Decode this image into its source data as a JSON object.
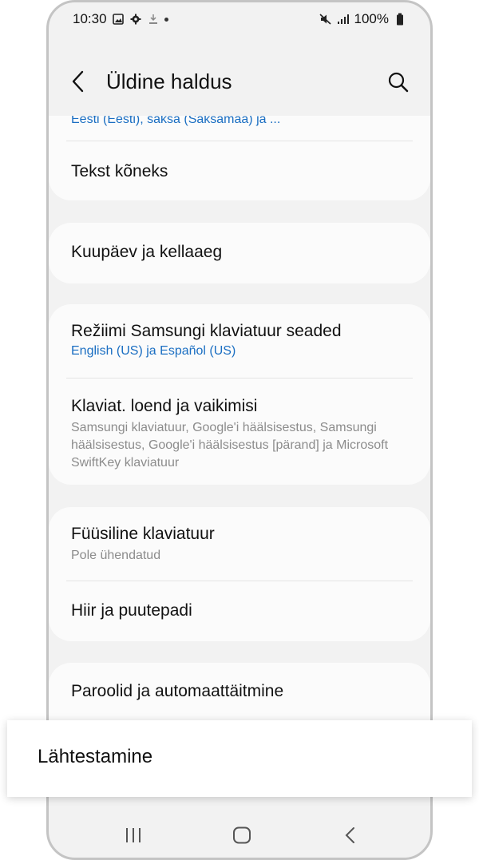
{
  "status_bar": {
    "time": "10:30",
    "battery": "100%"
  },
  "app_bar": {
    "title": "Üldine haldus"
  },
  "items": {
    "languages_subtitle": "Eesti (Eesti), saksa (Saksamaa) ja ...",
    "tts": "Tekst kõneks",
    "date_time": "Kuupäev ja kellaaeg",
    "samsung_kb_title": "Režiimi Samsungi klaviatuur seaded",
    "samsung_kb_subtitle": "English (US) ja Español (US)",
    "kb_list_title": "Klaviat. loend ja vaikimisi",
    "kb_list_subtitle": "Samsungi klaviatuur, Google'i häälsisestus, Samsungi häälsisestus, Google'i häälsisestus [pärand] ja Microsoft SwiftKey klaviatuur",
    "physical_kb_title": "Füüsiline klaviatuur",
    "physical_kb_subtitle": "Pole ühendatud",
    "mouse": "Hiir ja puutepadi",
    "passwords": "Paroolid ja automaattäitmine"
  },
  "overlay": {
    "label": "Lähtestamine"
  },
  "colors": {
    "accent": "#1a6ec2",
    "background": "#f2f2f2",
    "card": "#fbfbfb"
  }
}
